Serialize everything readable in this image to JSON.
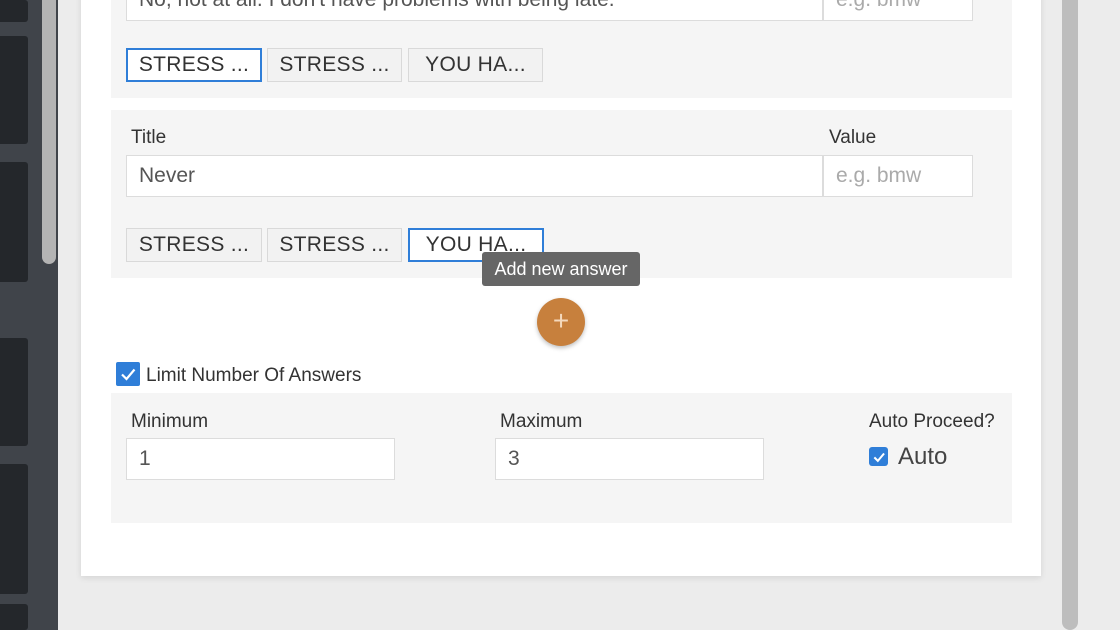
{
  "answers": [
    {
      "title_value": "No, not at all. I don't have problems with being late.",
      "value_placeholder": "e.g. bmw",
      "tags": [
        "STRESS ...",
        "STRESS ...",
        "YOU HA..."
      ]
    },
    {
      "title_label": "Title",
      "value_label": "Value",
      "title_value": "Never",
      "value_placeholder": "e.g. bmw",
      "tags": [
        "STRESS ...",
        "STRESS ...",
        "YOU HA..."
      ]
    }
  ],
  "add_answer": {
    "tooltip": "Add new answer",
    "icon": "+"
  },
  "limit": {
    "label": "Limit Number Of Answers",
    "checked": true,
    "minimum_label": "Minimum",
    "minimum_value": "1",
    "maximum_label": "Maximum",
    "maximum_value": "3",
    "auto_proceed_label": "Auto Proceed?",
    "auto_label": "Auto",
    "auto_checked": true
  },
  "colors": {
    "accent": "#2f7ed8",
    "add_button": "#c7803d"
  }
}
